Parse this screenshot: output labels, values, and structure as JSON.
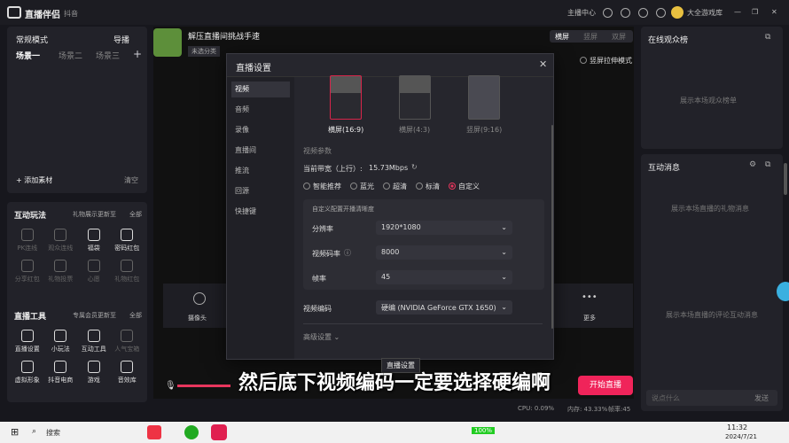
{
  "app": {
    "title": "直播伴侣",
    "subtitle": "抖音"
  },
  "topbar": {
    "host_center": "主播中心",
    "username": "大全游戏库"
  },
  "left": {
    "mode": "常规模式",
    "import": "导播",
    "scenes": [
      "场景一",
      "场景二",
      "场景三"
    ],
    "add_material": "添加素材",
    "clear": "清空",
    "interactive_title": "互动玩法",
    "interactive_notice": "礼物展示更新至",
    "all": "全部",
    "interactive_tools": [
      {
        "label": "PK连线",
        "icon": "pk-icon",
        "active": false
      },
      {
        "label": "观众连线",
        "icon": "audience-link-icon",
        "active": false
      },
      {
        "label": "福袋",
        "icon": "lucky-bag-icon",
        "active": true
      },
      {
        "label": "密码红包",
        "icon": "red-packet-icon",
        "active": true
      },
      {
        "label": "分享红包",
        "icon": "share-icon",
        "active": false
      },
      {
        "label": "礼物投票",
        "icon": "gift-vote-icon",
        "active": false
      },
      {
        "label": "心愿",
        "icon": "wish-icon",
        "active": false
      },
      {
        "label": "礼物红包",
        "icon": "gift-packet-icon",
        "active": false
      }
    ],
    "live_tools_title": "直播工具",
    "live_tools_notice": "专属会员更新至",
    "live_tools": [
      {
        "label": "直播设置",
        "icon": "settings-icon",
        "active": true
      },
      {
        "label": "小玩法",
        "icon": "mini-game-icon",
        "active": true
      },
      {
        "label": "互动工具",
        "icon": "puzzle-icon",
        "active": true
      },
      {
        "label": "人气宝箱",
        "icon": "chest-icon",
        "active": false
      },
      {
        "label": "虚拟形象",
        "icon": "avatar-icon",
        "active": true
      },
      {
        "label": "抖音电商",
        "icon": "shop-icon",
        "active": true
      },
      {
        "label": "游戏",
        "icon": "game-icon",
        "active": true
      },
      {
        "label": "音效库",
        "icon": "music-icon",
        "active": true
      }
    ]
  },
  "stream": {
    "title": "解压直播间挑战手速",
    "category": "未选分类",
    "orient_tabs": [
      "横屏",
      "竖屏",
      "双屏"
    ],
    "portrait_mode": "竖屏拉伸模式",
    "camera": "摄像头",
    "more": "更多",
    "start_live": "开始直播",
    "tooltip": "直播设置"
  },
  "dialog": {
    "title": "直播设置",
    "nav": [
      "视频",
      "音频",
      "录像",
      "直播间",
      "推流",
      "回源",
      "快捷键"
    ],
    "previews": [
      "横屏(16:9)",
      "横屏(4:3)",
      "竖屏(9:16)"
    ],
    "video_params": "视频参数",
    "bandwidth_label": "当前带宽（上行）:",
    "bandwidth_value": "15.73Mbps",
    "quality_options": [
      "智能推荐",
      "蓝光",
      "超清",
      "标清",
      "自定义"
    ],
    "custom_note": "自定义配置开播清晰度",
    "resolution_label": "分辨率",
    "resolution": "1920*1080",
    "bitrate_label": "视频码率",
    "bitrate": "8000",
    "fps_label": "帧率",
    "fps": "45",
    "encoder_label": "视频编码",
    "encoder": "硬编 (NVIDIA GeForce GTX 1650)",
    "advanced": "高级设置"
  },
  "right": {
    "audience_title": "在线观众榜",
    "audience_empty": "展示本场观众榜单",
    "interact_title": "互动消息",
    "gift_empty": "展示本场直播的礼物消息",
    "comment_empty": "展示本场直播的评论互动消息",
    "input_placeholder": "说点什么",
    "send": "发送"
  },
  "status": {
    "cpu": "CPU: 0.09%",
    "memory": "内存: 43.33%",
    "fps": "帧率:45"
  },
  "caption": "然后底下视频编码一定要选择硬编啊",
  "taskbar": {
    "search": "搜索",
    "battery": "100%",
    "time": "11:32",
    "date": "2024/7/21"
  }
}
